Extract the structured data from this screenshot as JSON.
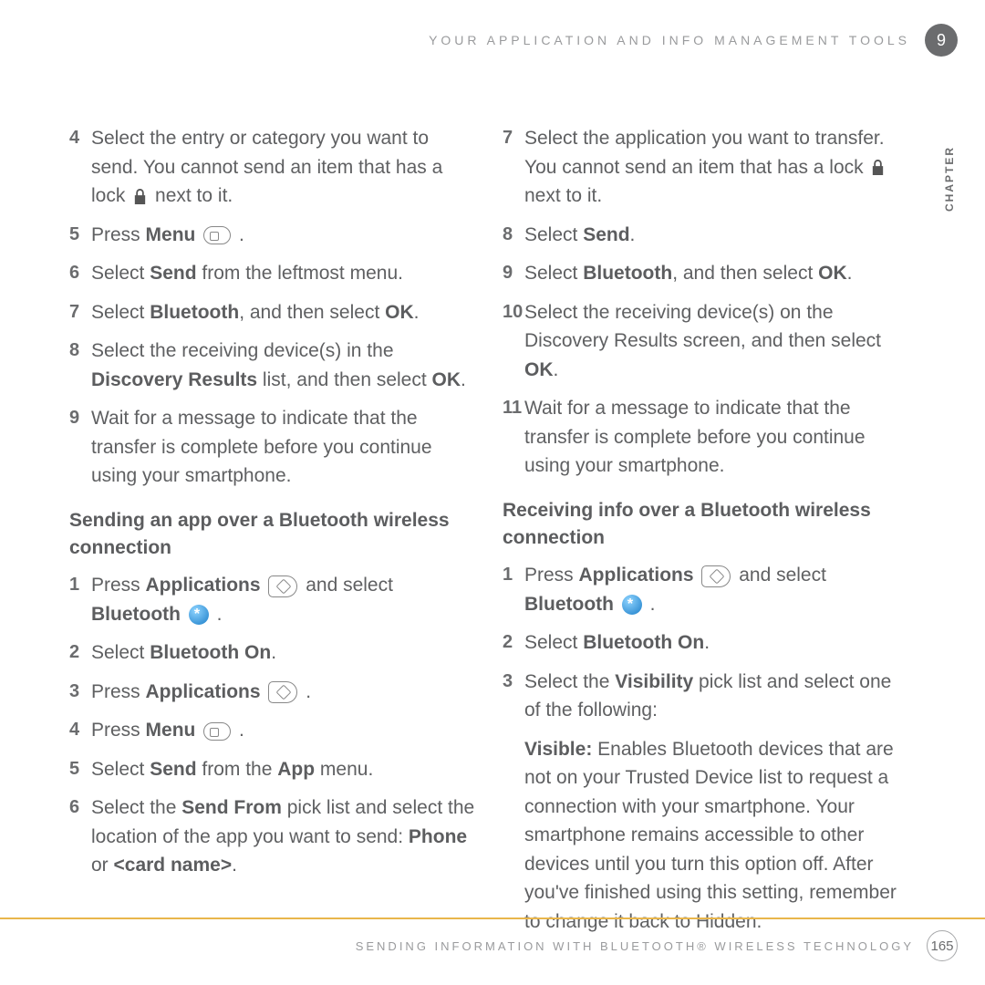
{
  "header": "YOUR APPLICATION AND INFO MANAGEMENT TOOLS",
  "chapter_num": "9",
  "chapter_label": "CHAPTER",
  "footer": "SENDING INFORMATION WITH BLUETOOTH® WIRELESS TECHNOLOGY",
  "page_num": "165",
  "left": {
    "i4": {
      "n": "4",
      "a": "Select the entry or category you want to send. You cannot send an item that has a lock ",
      "b": " next to it."
    },
    "i5": {
      "n": "5",
      "a": "Press ",
      "b": "Menu",
      "c": " ."
    },
    "i6": {
      "n": "6",
      "a": "Select ",
      "b": "Send",
      "c": " from the leftmost menu."
    },
    "i7": {
      "n": "7",
      "a": "Select ",
      "b": "Bluetooth",
      "c": ", and then select ",
      "d": "OK",
      "e": "."
    },
    "i8": {
      "n": "8",
      "a": "Select the receiving device(s) in the ",
      "b": "Discovery Results",
      "c": " list, and then select ",
      "d": "OK",
      "e": "."
    },
    "i9": {
      "n": "9",
      "t": "Wait for a message to indicate that the transfer is complete before you continue using your smartphone."
    },
    "h1": "Sending an app over a Bluetooth wireless connection",
    "s1": {
      "n": "1",
      "a": "Press ",
      "b": "Applications",
      "c": " and select ",
      "d": "Bluetooth",
      "e": " ."
    },
    "s2": {
      "n": "2",
      "a": "Select ",
      "b": "Bluetooth On",
      "c": "."
    },
    "s3": {
      "n": "3",
      "a": "Press ",
      "b": "Applications",
      "c": " ."
    },
    "s4": {
      "n": "4",
      "a": "Press ",
      "b": "Menu",
      "c": " ."
    },
    "s5": {
      "n": "5",
      "a": "Select ",
      "b": "Send",
      "c": " from the ",
      "d": "App",
      "e": " menu."
    },
    "s6": {
      "n": "6",
      "a": "Select the ",
      "b": "Send From",
      "c": " pick list and select the location of the app you want to send: ",
      "d": "Phone",
      "e": " or ",
      "f": "<card name>",
      "g": "."
    }
  },
  "right": {
    "i7": {
      "n": "7",
      "a": "Select the application you want to transfer. You cannot send an item that has a lock ",
      "b": " next to it."
    },
    "i8": {
      "n": "8",
      "a": "Select ",
      "b": "Send",
      "c": "."
    },
    "i9": {
      "n": "9",
      "a": "Select ",
      "b": "Bluetooth",
      "c": ", and then select ",
      "d": "OK",
      "e": "."
    },
    "i10": {
      "n": "10",
      "a": "Select the receiving device(s) on the Discovery Results screen, and then select ",
      "b": "OK",
      "c": "."
    },
    "i11": {
      "n": "11",
      "t": "Wait for a message to indicate that the transfer is complete before you continue using your smartphone."
    },
    "h2": "Receiving info over a Bluetooth wireless connection",
    "r1": {
      "n": "1",
      "a": "Press ",
      "b": "Applications",
      "c": " and select ",
      "d": "Bluetooth",
      "e": " ."
    },
    "r2": {
      "n": "2",
      "a": "Select ",
      "b": "Bluetooth On",
      "c": "."
    },
    "r3": {
      "n": "3",
      "a": "Select the ",
      "b": "Visibility",
      "c": " pick list and select one of the following:"
    },
    "vis": {
      "a": "Visible:",
      "b": " Enables Bluetooth devices that are not on your Trusted Device list to request a connection with your smartphone. Your smartphone remains accessible to other devices until you turn this option off. After you've finished using this setting, remember to change it back to Hidden."
    }
  }
}
